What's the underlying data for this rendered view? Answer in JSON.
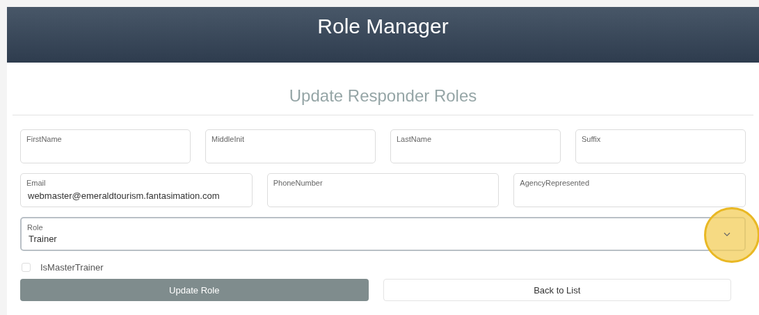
{
  "header": {
    "title": "Role Manager"
  },
  "form": {
    "title": "Update Responder Roles",
    "rows": [
      {
        "fields": [
          {
            "label": "FirstName"
          },
          {
            "label": "MiddleInit"
          },
          {
            "label": "LastName"
          },
          {
            "label": "Suffix"
          }
        ]
      },
      {
        "fields": [
          {
            "label": "Email",
            "value": "webmaster@emeraldtourism.fantasimation.com"
          },
          {
            "label": "PhoneNumber"
          },
          {
            "label": "AgencyRepresented"
          }
        ]
      }
    ],
    "role": {
      "label": "Role",
      "value": "Trainer",
      "highlighted": true
    },
    "checkbox": {
      "label": "IsMasterTrainer",
      "checked": false
    },
    "buttons": [
      {
        "label": "Update Role",
        "kind": "primary"
      },
      {
        "label": "Back to List",
        "kind": "secondary"
      }
    ]
  }
}
